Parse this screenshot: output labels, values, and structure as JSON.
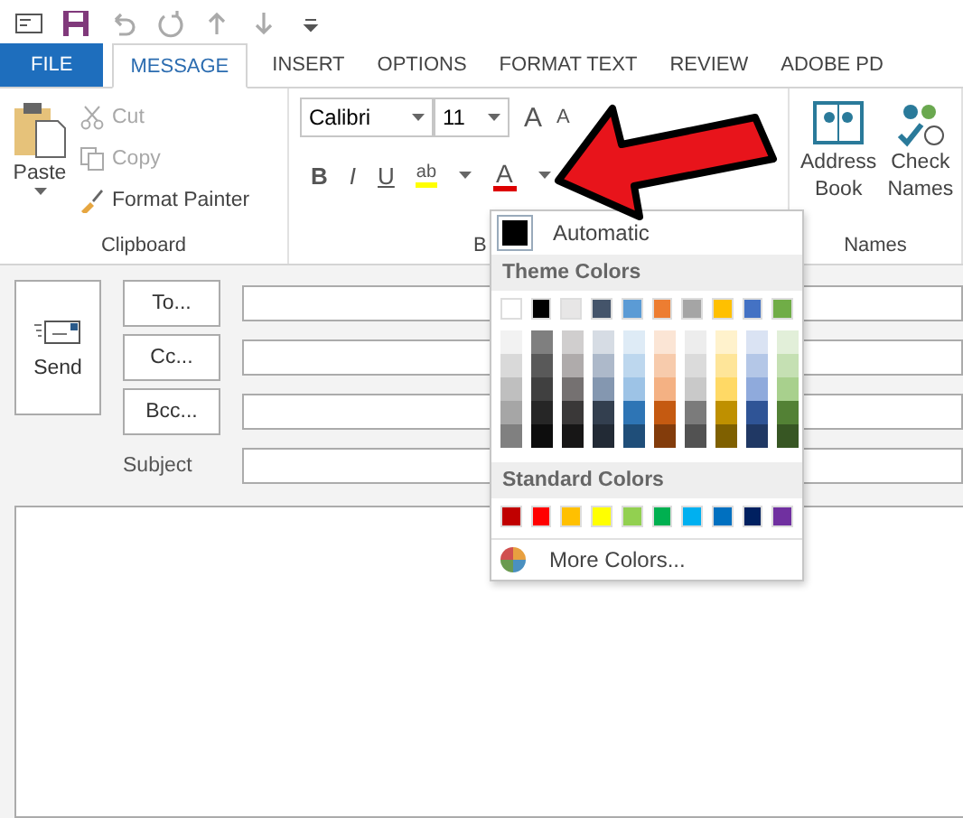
{
  "tabs": [
    {
      "label": "FILE",
      "kind": "file",
      "selected": false
    },
    {
      "label": "MESSAGE",
      "kind": "tab",
      "selected": true
    },
    {
      "label": "INSERT",
      "kind": "tab",
      "selected": false
    },
    {
      "label": "OPTIONS",
      "kind": "tab",
      "selected": false
    },
    {
      "label": "FORMAT TEXT",
      "kind": "tab",
      "selected": false
    },
    {
      "label": "REVIEW",
      "kind": "tab",
      "selected": false
    },
    {
      "label": "ADOBE PD",
      "kind": "tab",
      "selected": false
    }
  ],
  "clipboard": {
    "paste": "Paste",
    "cut": "Cut",
    "copy": "Copy",
    "format_painter": "Format Painter",
    "group_label": "Clipboard"
  },
  "basic_text": {
    "font": "Calibri",
    "size": "11",
    "grow": "A",
    "shrink": "A",
    "bold": "B",
    "italic": "I",
    "underline": "U",
    "highlight": "ab",
    "font_color": "A",
    "group_label": "B"
  },
  "names": {
    "address_book": "Address Book",
    "check_names": "Check Names",
    "group_label": "Names"
  },
  "compose": {
    "send": "Send",
    "to": "To...",
    "cc": "Cc...",
    "bcc": "Bcc...",
    "subject": "Subject"
  },
  "color_menu": {
    "automatic": "Automatic",
    "theme_heading": "Theme Colors",
    "standard_heading": "Standard Colors",
    "more": "More Colors...",
    "theme_colors": [
      {
        "color": "#ffffff",
        "shades": [
          {
            "color": "#f2f2f2"
          },
          {
            "color": "#d9d9d9"
          },
          {
            "color": "#bfbfbf"
          },
          {
            "color": "#a6a6a6"
          },
          {
            "color": "#808080"
          }
        ]
      },
      {
        "color": "#000000",
        "shades": [
          {
            "color": "#7f7f7f"
          },
          {
            "color": "#595959"
          },
          {
            "color": "#404040"
          },
          {
            "color": "#262626"
          },
          {
            "color": "#0d0d0d"
          }
        ]
      },
      {
        "color": "#e7e6e6",
        "shades": [
          {
            "color": "#d0cece"
          },
          {
            "color": "#afabab"
          },
          {
            "color": "#757171"
          },
          {
            "color": "#3a3838"
          },
          {
            "color": "#171616"
          }
        ]
      },
      {
        "color": "#44546a",
        "shades": [
          {
            "color": "#d6dce4"
          },
          {
            "color": "#adb9ca"
          },
          {
            "color": "#8497b0"
          },
          {
            "color": "#333f4f"
          },
          {
            "color": "#222a35"
          }
        ]
      },
      {
        "color": "#5b9bd5",
        "shades": [
          {
            "color": "#deebf6"
          },
          {
            "color": "#bdd7ee"
          },
          {
            "color": "#9dc3e6"
          },
          {
            "color": "#2e75b5"
          },
          {
            "color": "#1f4e79"
          }
        ]
      },
      {
        "color": "#ed7d31",
        "shades": [
          {
            "color": "#fbe5d5"
          },
          {
            "color": "#f7cbac"
          },
          {
            "color": "#f4b183"
          },
          {
            "color": "#c55a11"
          },
          {
            "color": "#833c0b"
          }
        ]
      },
      {
        "color": "#a5a5a5",
        "shades": [
          {
            "color": "#ededed"
          },
          {
            "color": "#dbdbdb"
          },
          {
            "color": "#c9c9c9"
          },
          {
            "color": "#7b7b7b"
          },
          {
            "color": "#525252"
          }
        ]
      },
      {
        "color": "#ffc000",
        "shades": [
          {
            "color": "#fff2cc"
          },
          {
            "color": "#fee599"
          },
          {
            "color": "#ffd965"
          },
          {
            "color": "#bf9000"
          },
          {
            "color": "#7f6000"
          }
        ]
      },
      {
        "color": "#4472c4",
        "shades": [
          {
            "color": "#dae3f3"
          },
          {
            "color": "#b4c7e7"
          },
          {
            "color": "#8faadc"
          },
          {
            "color": "#2f5496"
          },
          {
            "color": "#203864"
          }
        ]
      },
      {
        "color": "#70ad47",
        "shades": [
          {
            "color": "#e2efd9"
          },
          {
            "color": "#c5e0b3"
          },
          {
            "color": "#a8d08d"
          },
          {
            "color": "#538135"
          },
          {
            "color": "#375623"
          }
        ]
      }
    ],
    "standard_colors": [
      {
        "color": "#c00000"
      },
      {
        "color": "#ff0000"
      },
      {
        "color": "#ffc000"
      },
      {
        "color": "#ffff00"
      },
      {
        "color": "#92d050"
      },
      {
        "color": "#00b050"
      },
      {
        "color": "#00b0f0"
      },
      {
        "color": "#0070c0"
      },
      {
        "color": "#002060"
      },
      {
        "color": "#7030a0"
      }
    ]
  }
}
